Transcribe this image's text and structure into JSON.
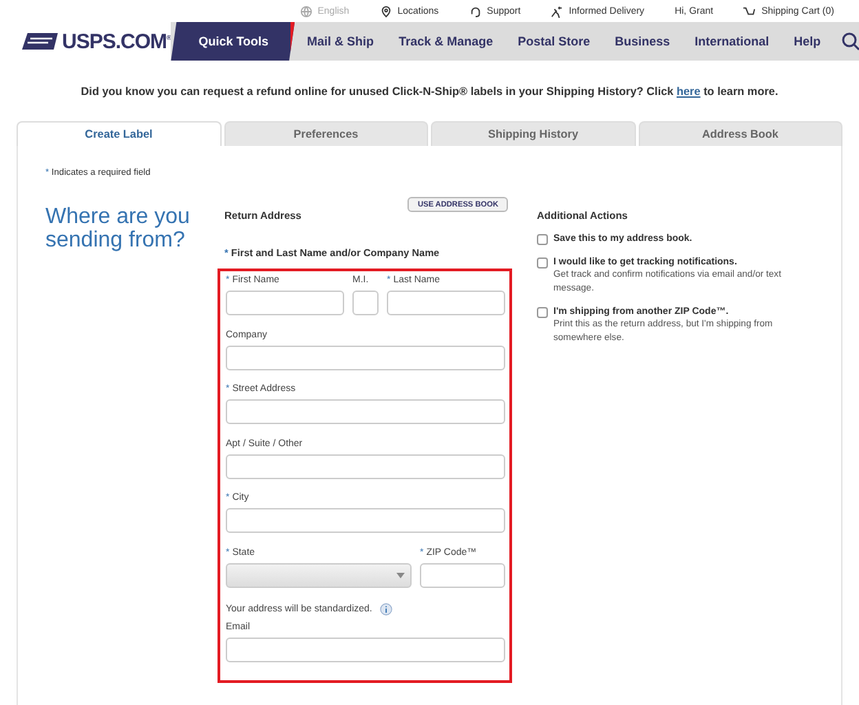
{
  "utility_links": [
    {
      "kind": "globe",
      "label": "English",
      "disabled": true
    },
    {
      "kind": "pin",
      "label": "Locations",
      "disabled": false
    },
    {
      "kind": "headset",
      "label": "Support",
      "disabled": false
    },
    {
      "kind": "mail",
      "label": "Informed Delivery",
      "disabled": false
    },
    {
      "kind": "none",
      "label": "Hi, Grant",
      "disabled": false
    },
    {
      "kind": "cart",
      "label": "Shipping Cart (0)",
      "disabled": false
    }
  ],
  "logo": "USPS.COM",
  "logo_mark": "®",
  "nav": [
    {
      "label": "Quick Tools",
      "selected": true
    },
    {
      "label": "Mail & Ship",
      "selected": false
    },
    {
      "label": "Track & Manage",
      "selected": false
    },
    {
      "label": "Postal Store",
      "selected": false
    },
    {
      "label": "Business",
      "selected": false
    },
    {
      "label": "International",
      "selected": false
    },
    {
      "label": "Help",
      "selected": false
    }
  ],
  "banner": {
    "before": "Did you know you can request a refund online for unused Click-N-Ship® labels in your Shipping History? Click",
    "link": "here",
    "after": "to learn more."
  },
  "tabs": [
    {
      "label": "Create Label",
      "selected": true
    },
    {
      "label": "Preferences",
      "selected": false
    },
    {
      "label": "Shipping History",
      "selected": false
    },
    {
      "label": "Address Book",
      "selected": false
    }
  ],
  "required_note": {
    "mark": "*",
    "text": "Indicates a required field"
  },
  "heading": "Where are you sending from?",
  "return_address": {
    "title": "Return Address",
    "address_book_button": "USE ADDRESS BOOK",
    "name_hint": {
      "mark": "*",
      "text": "First and Last Name and/or Company Name"
    },
    "rows": [
      [
        {
          "label": "First Name",
          "required": true,
          "kind": "text"
        },
        {
          "label": "M.I.",
          "required": false,
          "kind": "text"
        },
        {
          "label": "Last Name",
          "required": true,
          "kind": "text"
        }
      ],
      [
        {
          "label": "Company",
          "required": false,
          "kind": "text"
        }
      ],
      [
        {
          "label": "Street Address",
          "required": true,
          "kind": "text"
        }
      ],
      [
        {
          "label": "Apt / Suite / Other",
          "required": false,
          "kind": "text"
        }
      ],
      [
        {
          "label": "City",
          "required": true,
          "kind": "text"
        }
      ],
      [
        {
          "label": "State",
          "required": true,
          "kind": "select"
        },
        {
          "label": "ZIP Code™",
          "required": true,
          "kind": "text"
        }
      ],
      [
        {
          "kind": "note",
          "label": "Your address will be standardized."
        }
      ],
      [
        {
          "label": "Email",
          "required": false,
          "kind": "text"
        }
      ]
    ],
    "required_mark": "*"
  },
  "additional_actions": {
    "title": "Additional Actions",
    "options": [
      {
        "label": "Save this to my address book.",
        "checked": false
      },
      {
        "label": "I would like to get tracking notifications.",
        "detail": "Get track and confirm notifications via email and/or text message.",
        "checked": false
      },
      {
        "label": "I'm shipping from another ZIP Code™.",
        "detail": "Print this as the return address, but I'm shipping from somewhere else.",
        "checked": false
      }
    ]
  }
}
